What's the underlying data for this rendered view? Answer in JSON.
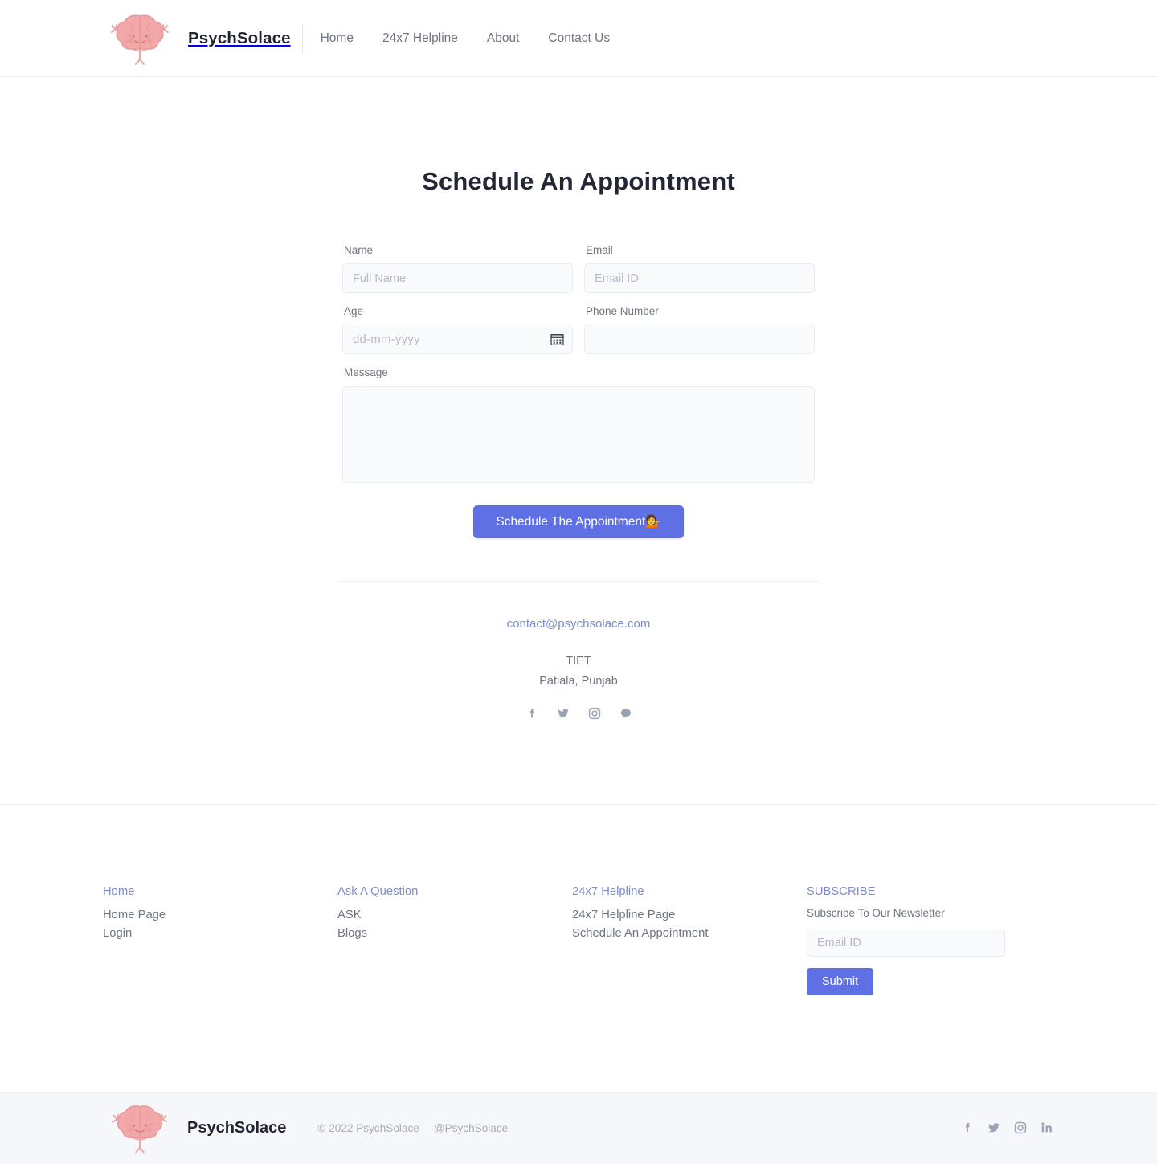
{
  "brand": {
    "name": "PsychSolace",
    "logo_icon": "meditating-brain-mascot-icon"
  },
  "nav": {
    "links": [
      {
        "label": "Home"
      },
      {
        "label": "24x7 Helpline"
      },
      {
        "label": "About"
      },
      {
        "label": "Contact Us"
      }
    ]
  },
  "main": {
    "title": "Schedule An Appointment",
    "fields": {
      "name": {
        "label": "Name",
        "placeholder": "Full Name",
        "value": ""
      },
      "email": {
        "label": "Email",
        "placeholder": "Email ID",
        "value": ""
      },
      "age": {
        "label": "Age",
        "placeholder": "dd-mm-yyyy",
        "value": "",
        "icon": "calendar-icon"
      },
      "phone": {
        "label": "Phone Number",
        "placeholder": "",
        "value": ""
      },
      "message": {
        "label": "Message",
        "placeholder": "",
        "value": ""
      }
    },
    "submit_label": "Schedule The Appointment💁"
  },
  "contact": {
    "email": "contact@psychsolace.com",
    "org": "TIET",
    "city": "Patiala, Punjab",
    "socials": [
      {
        "name": "facebook-icon"
      },
      {
        "name": "twitter-icon"
      },
      {
        "name": "instagram-icon"
      },
      {
        "name": "chat-bubble-icon"
      }
    ]
  },
  "footer": {
    "columns": [
      {
        "head": "Home",
        "links": [
          {
            "label": "Home Page"
          },
          {
            "label": "Login"
          }
        ]
      },
      {
        "head": "Ask A Question",
        "links": [
          {
            "label": "ASK"
          },
          {
            "label": "Blogs"
          }
        ]
      },
      {
        "head": "24x7 Helpline",
        "links": [
          {
            "label": "24x7 Helpline Page"
          },
          {
            "label": "Schedule An Appointment"
          }
        ]
      }
    ],
    "subscribe": {
      "head": "SUBSCRIBE",
      "note": "Subscribe To Our Newsletter",
      "placeholder": "Email ID",
      "value": "",
      "submit_label": "Submit"
    }
  },
  "bottombar": {
    "name": "PsychSolace",
    "copyright": "© 2022 PsychSolace",
    "handle": "@PsychSolace",
    "socials": [
      {
        "name": "facebook-icon"
      },
      {
        "name": "twitter-icon"
      },
      {
        "name": "instagram-icon"
      },
      {
        "name": "linkedin-icon"
      }
    ]
  },
  "colors": {
    "accent": "#5f6fe4",
    "link": "#7f8cc9",
    "muted": "#6f7581",
    "bottombar_bg": "#f5f7fa",
    "input_bg": "#f9fafc",
    "mascot_pink": "#f0a6a6"
  }
}
